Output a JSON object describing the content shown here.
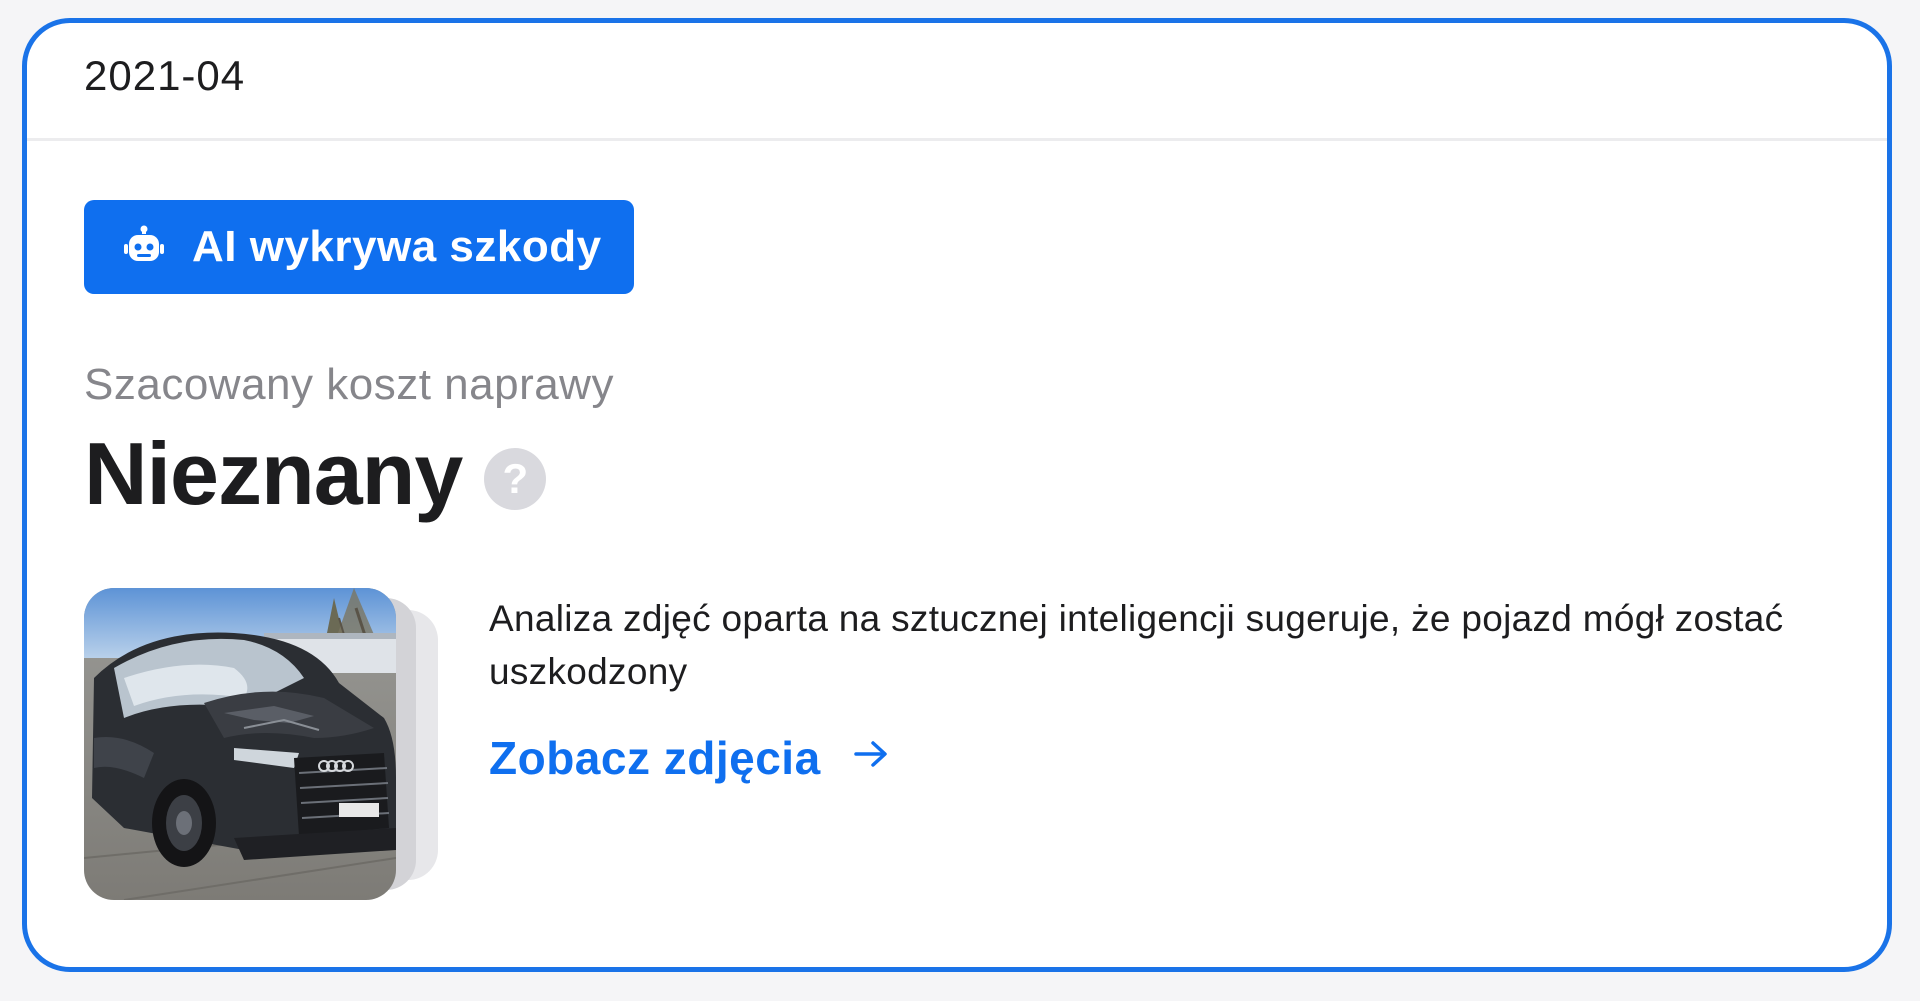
{
  "header": {
    "date": "2021-04"
  },
  "badge": {
    "label": "AI wykrywa szkody",
    "icon": "robot-icon",
    "color": "#0f6fef"
  },
  "cost": {
    "label": "Szacowany koszt naprawy",
    "value": "Nieznany",
    "help_icon": "?"
  },
  "analysis": {
    "description": "Analiza zdjęć oparta na sztucznej inteligencji sugeruje, że pojazd mógł zostać uszkodzony",
    "link_label": "Zobacz zdjęcia",
    "link_icon": "arrow-right-icon"
  },
  "colors": {
    "accent": "#0f6fef",
    "border": "#1a73e8",
    "muted_text": "#86868b"
  }
}
